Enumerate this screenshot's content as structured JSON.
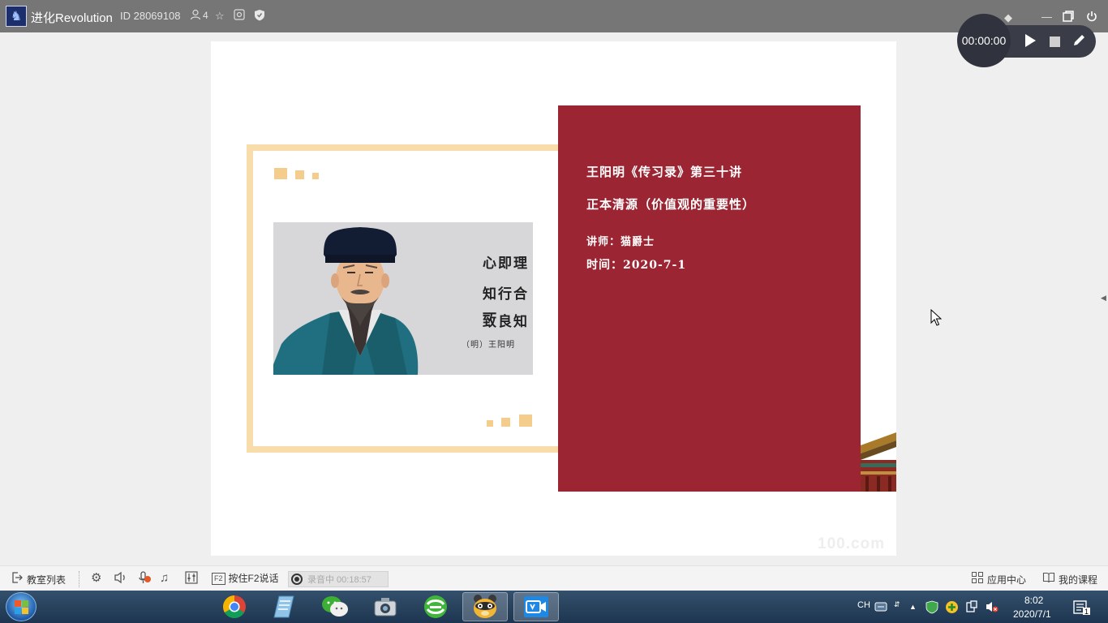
{
  "titlebar": {
    "app_logo_glyph": "♞",
    "room_name": "进化Revolution",
    "room_id": "ID 28069108",
    "member_icon": "person-icon",
    "member_count": "4",
    "icons": [
      "favorite-star-icon",
      "share-icon",
      "shield-icon",
      "skin-icon",
      "minimize-icon",
      "maximize-icon",
      "power-icon"
    ]
  },
  "recorder": {
    "timer": "00:00:00",
    "play_icon": "play-icon",
    "stop_icon": "stop-icon",
    "pen_icon": "pen-icon"
  },
  "slide": {
    "quote_lines": [
      "心即理",
      "知行合一",
      "致良知"
    ],
    "quote_signature": "（明）王阳明",
    "title": "王阳明《传习录》第三十讲",
    "subtitle": "正本清源（价值观的重要性）",
    "lecturer": "讲师：猫爵士",
    "date": "时间：2020-7-1",
    "watermark": "100.com",
    "colors": {
      "card": "#9b2532",
      "frame": "#f8dcaa",
      "accent": "#f4cc8c"
    }
  },
  "toolbar": {
    "classroom_list": "教室列表",
    "push_to_talk": "按住F2说话",
    "push_to_talk_key": "F2",
    "recording_status": "录音中 00:18:57",
    "app_center": "应用中心",
    "my_courses": "我的课程"
  },
  "taskbar": {
    "apps": [
      "chrome",
      "notepad",
      "wechat",
      "screenshot-tool",
      "360-browser",
      "qq-pet",
      "classroom-app"
    ],
    "active_app": "classroom-app",
    "ime": "CH",
    "time": "8:02",
    "date": "2020/7/1",
    "notification_count": "1"
  }
}
